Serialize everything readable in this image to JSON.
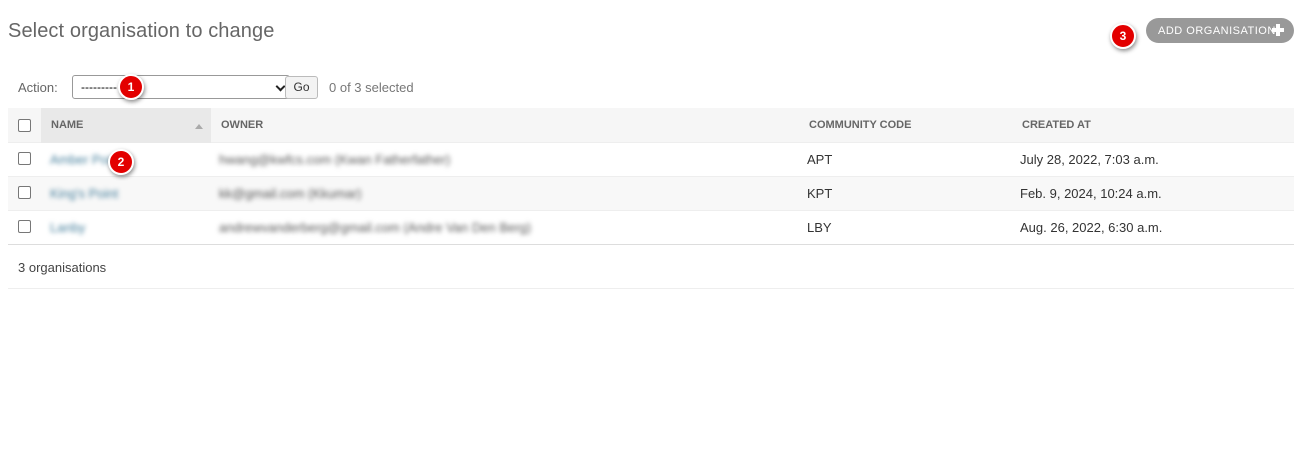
{
  "page": {
    "title": "Select organisation to change"
  },
  "header": {
    "add_label": "ADD ORGANISATION"
  },
  "actions": {
    "label": "Action:",
    "selected_option": "---------",
    "go_label": "Go",
    "selection_count": "0 of 3 selected"
  },
  "table": {
    "columns": [
      "NAME",
      "OWNER",
      "COMMUNITY CODE",
      "CREATED AT"
    ],
    "rows": [
      {
        "name": "Amber Point",
        "owner": "hwang@kwfcs.com (Kwan Fatherfather)",
        "code": "APT",
        "created": "July 28, 2022, 7:03 a.m."
      },
      {
        "name": "King's Point",
        "owner": "kk@gmail.com (Kkumar)",
        "code": "KPT",
        "created": "Feb. 9, 2024, 10:24 a.m."
      },
      {
        "name": "Lanby",
        "owner": "andrewvanderberg@gmail.com (Andre Van Den Berg)",
        "code": "LBY",
        "created": "Aug. 26, 2022, 6:30 a.m."
      }
    ]
  },
  "paginator": {
    "text": "3 organisations"
  },
  "badges": [
    "1",
    "2",
    "3"
  ]
}
